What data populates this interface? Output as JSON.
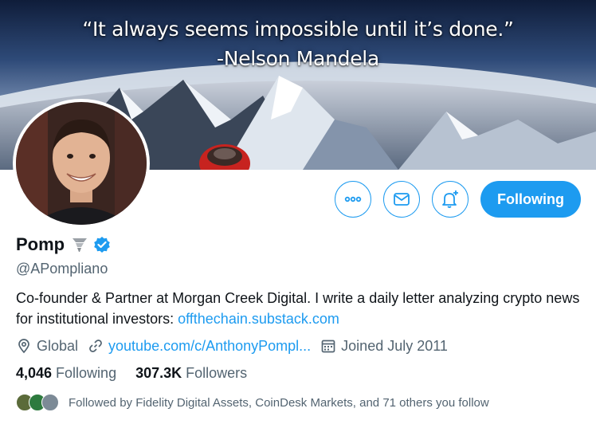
{
  "banner": {
    "quote_line1": "“It always seems impossible until it’s done.”",
    "quote_line2": "-Nelson Mandela"
  },
  "actions": {
    "more_icon": "more-icon",
    "message_icon": "envelope-icon",
    "notify_icon": "bell-plus-icon",
    "follow_label": "Following"
  },
  "profile": {
    "name": "Pomp",
    "name_emoji": "🌪",
    "handle": "@APompliano",
    "bio_text": "Co-founder & Partner at Morgan Creek Digital. I write a daily letter analyzing crypto news for institutional investors: ",
    "bio_link": "offthechain.substack.com",
    "location": "Global",
    "website": "youtube.com/c/AnthonyPompl...",
    "joined": "Joined July 2011"
  },
  "stats": {
    "following_count": "4,046",
    "following_label": "Following",
    "followers_count": "307.3K",
    "followers_label": "Followers"
  },
  "followed_by": "Followed by Fidelity Digital Assets, CoinDesk Markets, and 71 others you follow",
  "colors": {
    "accent": "#1d9bf0",
    "muted": "#536471"
  }
}
